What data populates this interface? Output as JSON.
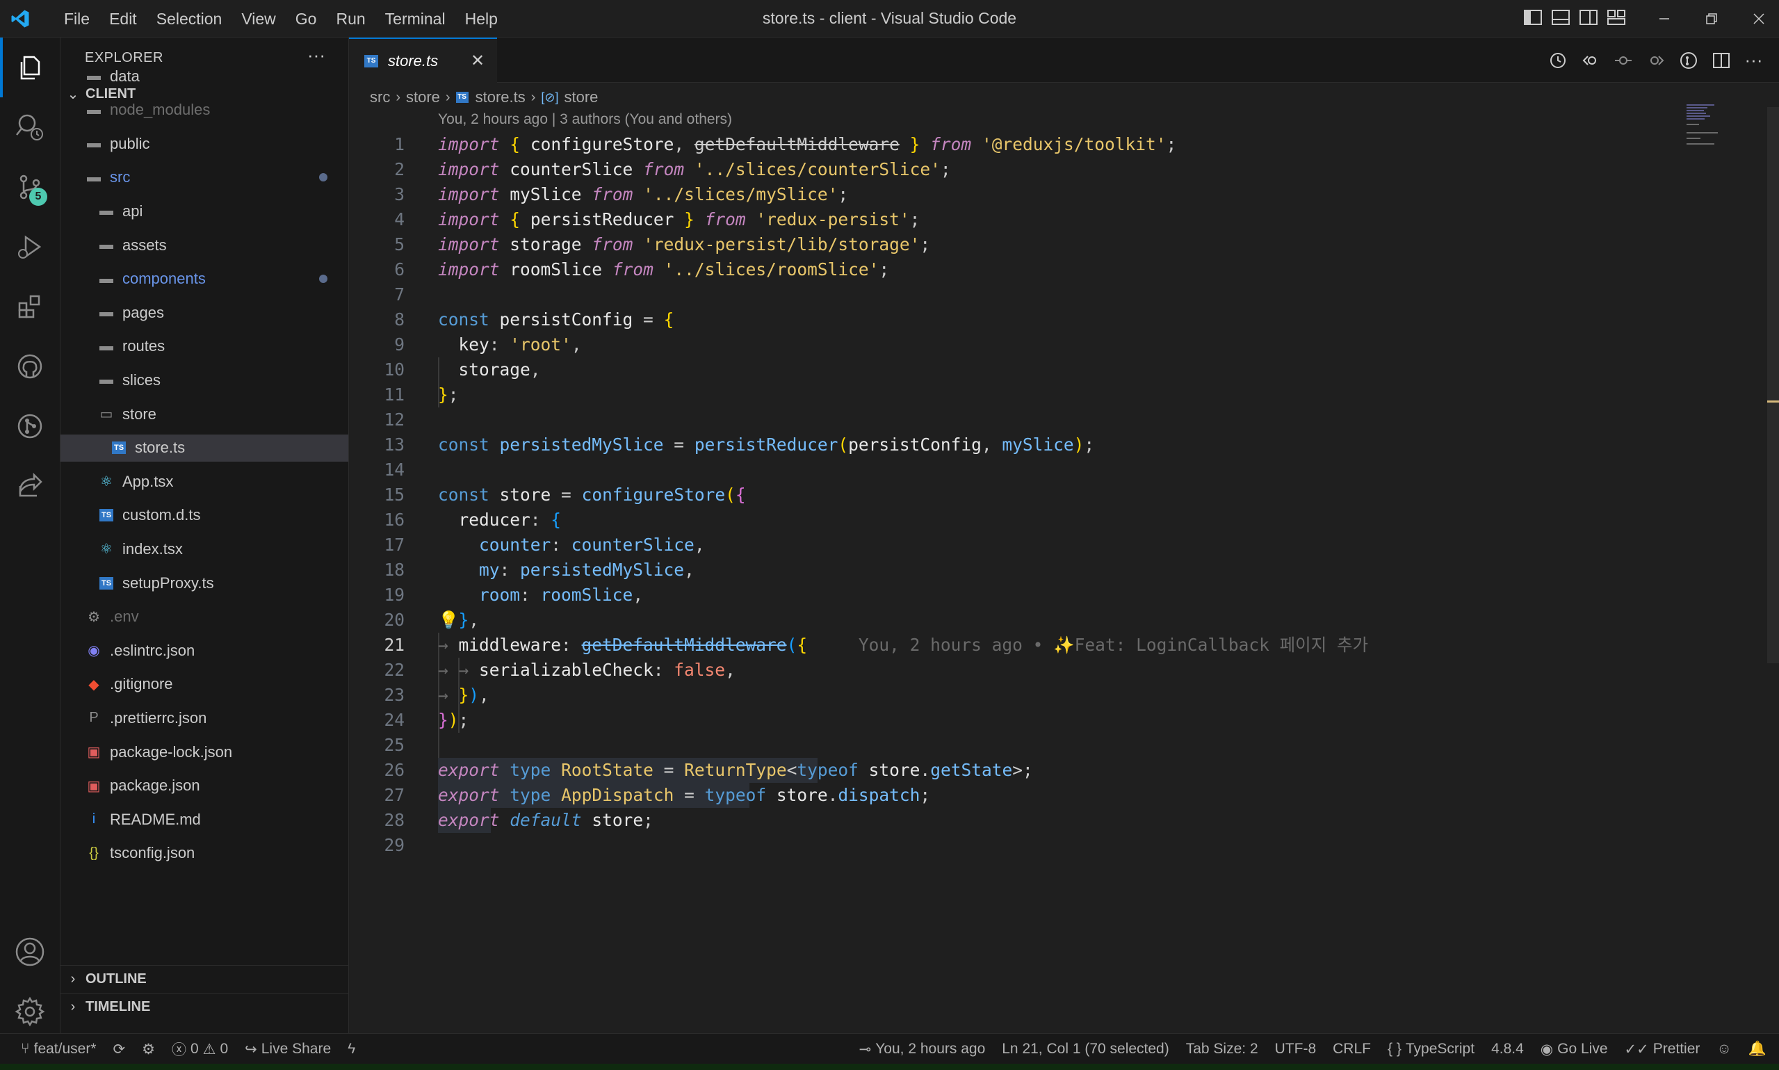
{
  "titlebar": {
    "menu": [
      "File",
      "Edit",
      "Selection",
      "View",
      "Go",
      "Run",
      "Terminal",
      "Help"
    ],
    "title": "store.ts - client - Visual Studio Code"
  },
  "activity": {
    "items": [
      "explorer-icon",
      "search-icon",
      "source-control-icon",
      "run-debug-icon",
      "extensions-icon",
      "github-icon",
      "git-graph-icon",
      "live-share-icon"
    ],
    "source_control_badge": "5",
    "bottom": [
      "accounts-icon",
      "settings-gear-icon"
    ]
  },
  "sidebar": {
    "title": "EXPLORER",
    "more": "···",
    "root": "CLIENT",
    "tree": [
      {
        "label": "data",
        "kind": "folder",
        "indent": 0
      },
      {
        "label": "node_modules",
        "kind": "folder",
        "indent": 0,
        "dim": true
      },
      {
        "label": "public",
        "kind": "folder",
        "indent": 0
      },
      {
        "label": "src",
        "kind": "folder",
        "indent": 0,
        "modified": true
      },
      {
        "label": "api",
        "kind": "folder",
        "indent": 1
      },
      {
        "label": "assets",
        "kind": "folder",
        "indent": 1
      },
      {
        "label": "components",
        "kind": "folder",
        "indent": 1,
        "modified": true
      },
      {
        "label": "pages",
        "kind": "folder",
        "indent": 1
      },
      {
        "label": "routes",
        "kind": "folder",
        "indent": 1
      },
      {
        "label": "slices",
        "kind": "folder",
        "indent": 1
      },
      {
        "label": "store",
        "kind": "folder-open",
        "indent": 1
      },
      {
        "label": "store.ts",
        "kind": "ts",
        "indent": 2,
        "selected": true
      },
      {
        "label": "App.tsx",
        "kind": "react",
        "indent": 1
      },
      {
        "label": "custom.d.ts",
        "kind": "ts",
        "indent": 1
      },
      {
        "label": "index.tsx",
        "kind": "react",
        "indent": 1
      },
      {
        "label": "setupProxy.ts",
        "kind": "ts",
        "indent": 1
      },
      {
        "label": ".env",
        "kind": "env",
        "indent": 0,
        "dim": true
      },
      {
        "label": ".eslintrc.json",
        "kind": "eslint",
        "indent": 0
      },
      {
        "label": ".gitignore",
        "kind": "git",
        "indent": 0
      },
      {
        "label": ".prettierrc.json",
        "kind": "prettier",
        "indent": 0
      },
      {
        "label": "package-lock.json",
        "kind": "npm",
        "indent": 0
      },
      {
        "label": "package.json",
        "kind": "npm",
        "indent": 0
      },
      {
        "label": "README.md",
        "kind": "info",
        "indent": 0
      },
      {
        "label": "tsconfig.json",
        "kind": "json",
        "indent": 0
      }
    ],
    "outline": "OUTLINE",
    "timeline": "TIMELINE"
  },
  "editor": {
    "tab_label": "store.ts",
    "ts_icon_text": "TS",
    "breadcrumb": [
      "src",
      "store",
      "store.ts",
      "store"
    ],
    "codelens": "You, 2 hours ago | 3 authors (You and others)",
    "inline_blame": "You, 2 hours ago • ✨Feat: LoginCallback 페이지 추가",
    "current_line": 21,
    "line_count": 29
  },
  "statusbar": {
    "branch": "feat/user*",
    "errors": "0",
    "warnings": "0",
    "live_share": "Live Share",
    "blame": "You, 2 hours ago",
    "cursor": "Ln 21, Col 1 (70 selected)",
    "tab_size": "Tab Size: 2",
    "encoding": "UTF-8",
    "eol": "CRLF",
    "language": "TypeScript",
    "ts_version": "4.8.4",
    "go_live": "Go Live",
    "prettier": "Prettier"
  }
}
